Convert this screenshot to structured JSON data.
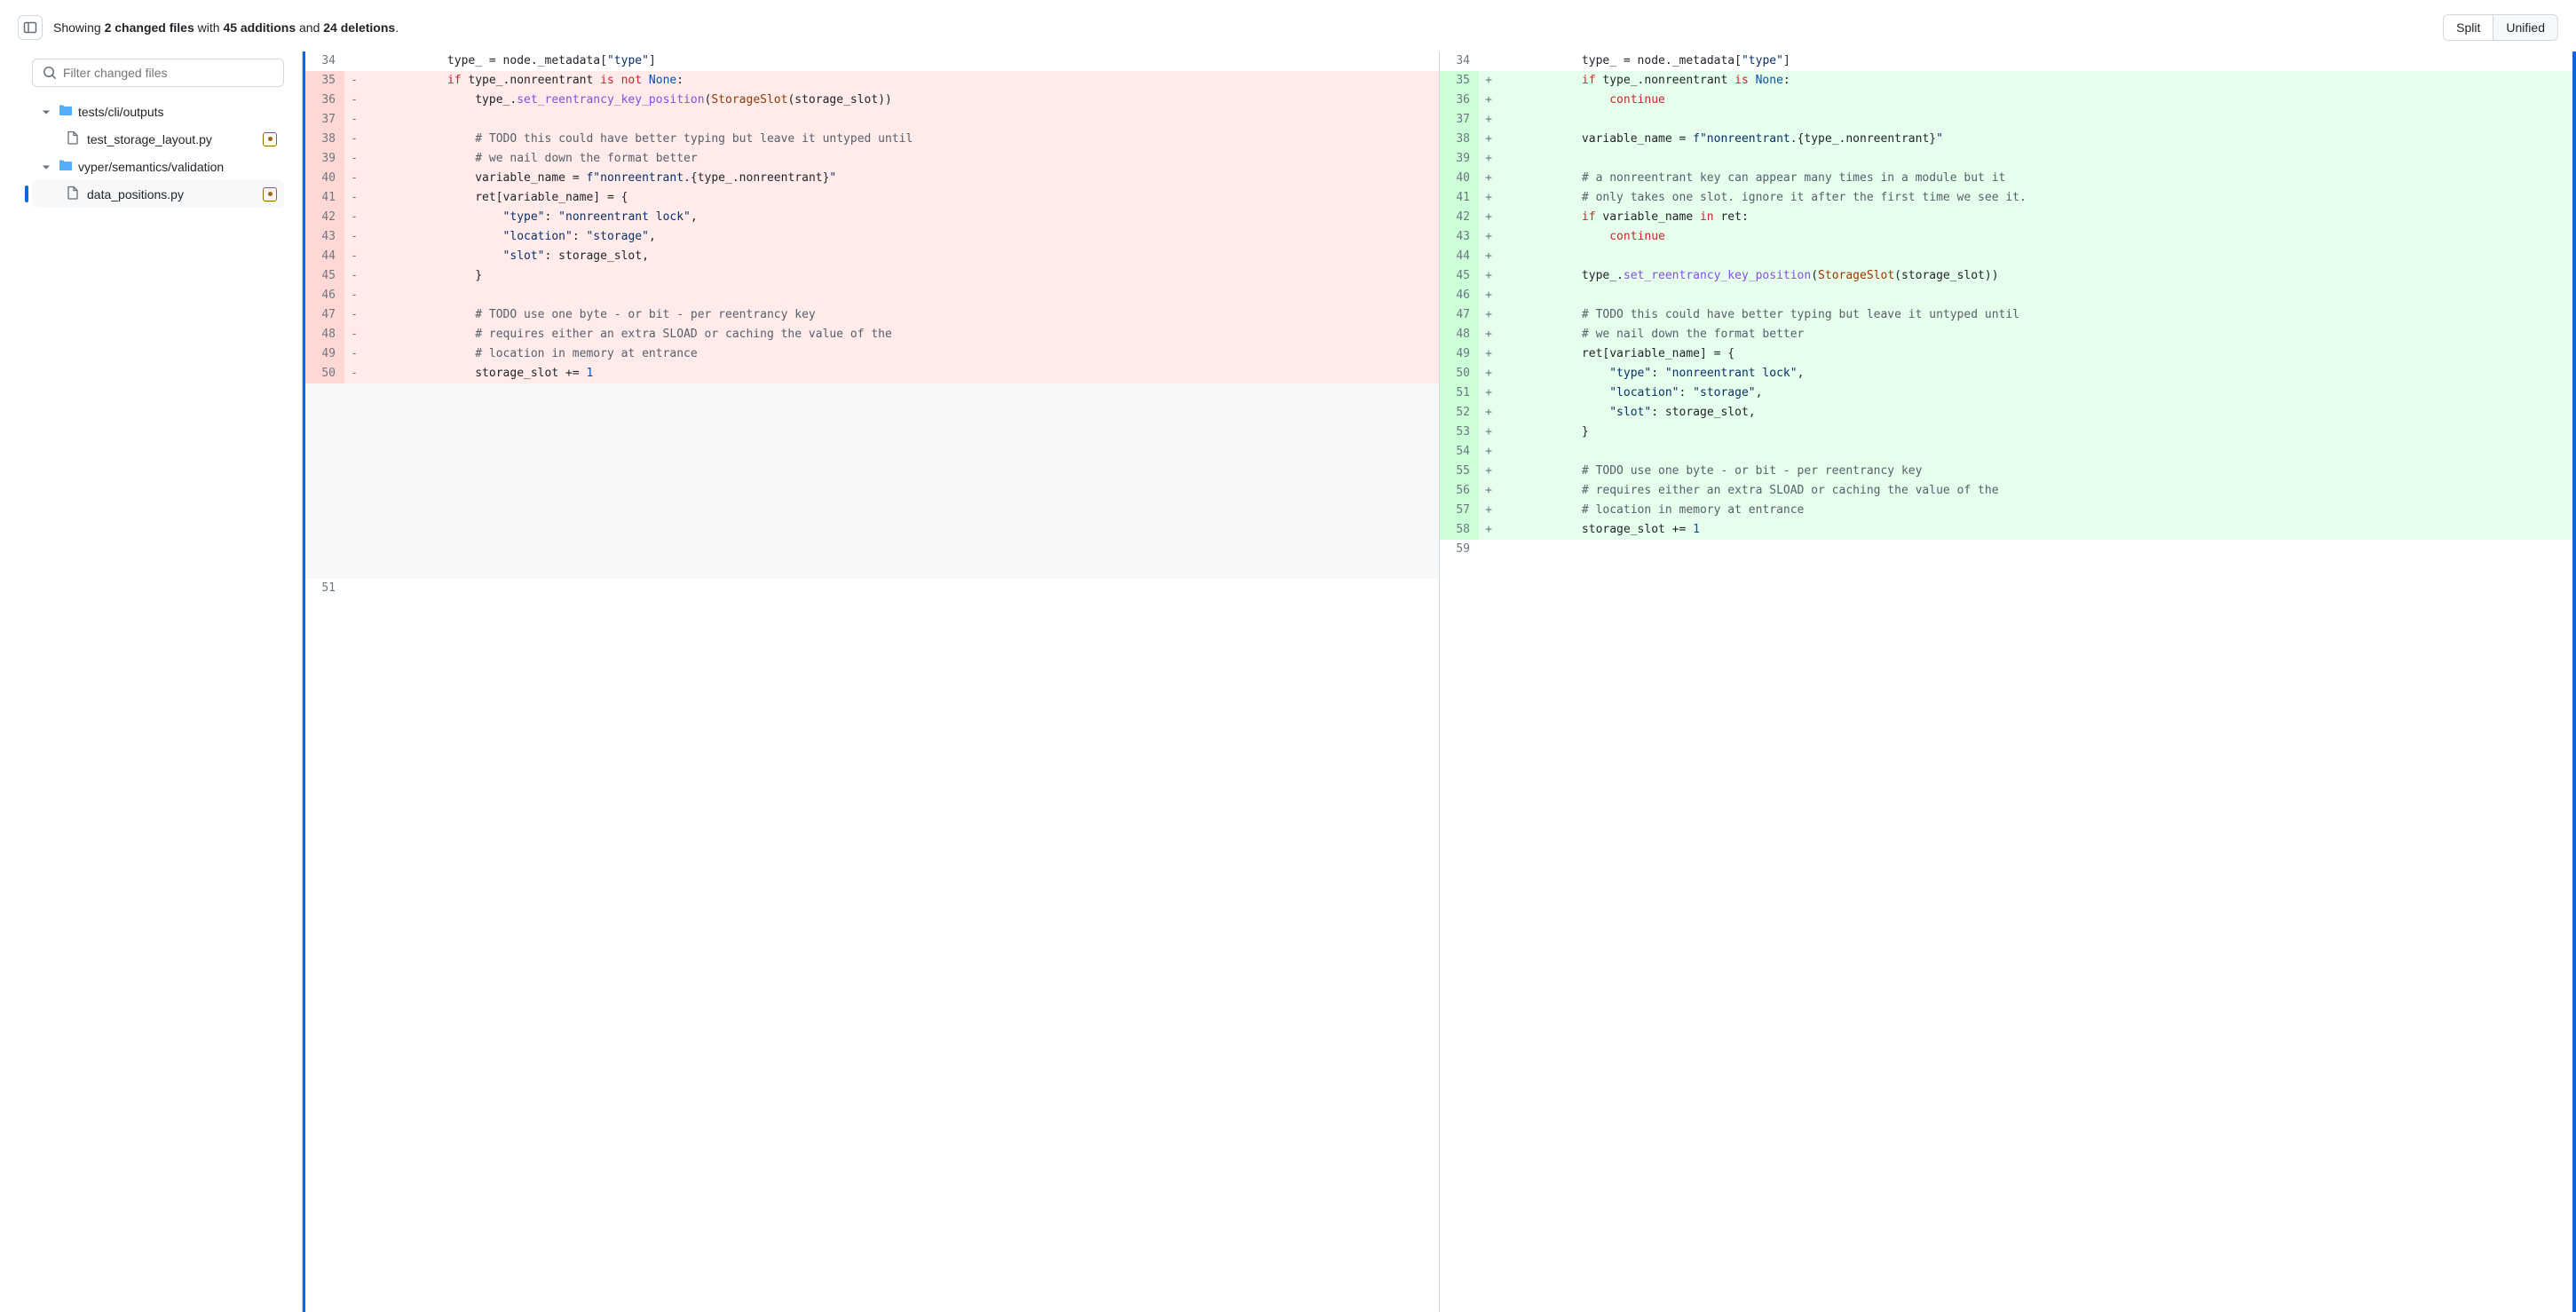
{
  "summary": {
    "prefix": "Showing ",
    "files": "2 changed files",
    "with": " with ",
    "additions": "45 additions",
    "and": " and ",
    "deletions": "24 deletions",
    "period": "."
  },
  "view_toggle": {
    "split": "Split",
    "unified": "Unified"
  },
  "filter": {
    "placeholder": "Filter changed files"
  },
  "tree": {
    "folder1": "tests/cli/outputs",
    "file1": "test_storage_layout.py",
    "folder2": "vyper/semantics/validation",
    "file2": "data_positions.py"
  },
  "diff": {
    "left": [
      {
        "n": "34",
        "t": "ctx",
        "code": [
          [
            "            type_ "
          ],
          [
            "= ",
            ""
          ],
          [
            "node",
            ""
          ],
          [
            ".",
            ""
          ],
          [
            "_metadata",
            ""
          ],
          [
            "[",
            ""
          ],
          [
            "\"type\"",
            "str"
          ],
          [
            "]",
            ""
          ]
        ]
      },
      {
        "n": "35",
        "t": "del",
        "code": [
          [
            "            ",
            ""
          ],
          [
            "if",
            "kw"
          ],
          [
            " type_",
            ""
          ],
          [
            ".",
            ""
          ],
          [
            "nonreentrant ",
            ""
          ],
          [
            "is",
            "kw"
          ],
          [
            " ",
            ""
          ],
          [
            "not",
            "kw"
          ],
          [
            " ",
            ""
          ],
          [
            "None",
            "num"
          ],
          [
            ":",
            ""
          ]
        ]
      },
      {
        "n": "36",
        "t": "del",
        "code": [
          [
            "                type_",
            ""
          ],
          [
            ".",
            ""
          ],
          [
            "set_reentrancy_key_position",
            "fn"
          ],
          [
            "(",
            ""
          ],
          [
            "StorageSlot",
            "cls"
          ],
          [
            "(storage_slot))",
            ""
          ]
        ]
      },
      {
        "n": "37",
        "t": "del",
        "code": [
          [
            "",
            ""
          ]
        ]
      },
      {
        "n": "38",
        "t": "del",
        "code": [
          [
            "                ",
            ""
          ],
          [
            "# TODO this could have better typing but leave it untyped until",
            "cmt"
          ]
        ]
      },
      {
        "n": "39",
        "t": "del",
        "code": [
          [
            "                ",
            ""
          ],
          [
            "# we nail down the format better",
            "cmt"
          ]
        ]
      },
      {
        "n": "40",
        "t": "del",
        "code": [
          [
            "                variable_name ",
            ""
          ],
          [
            "= ",
            ""
          ],
          [
            "f\"nonreentrant.",
            "str"
          ],
          [
            "{",
            ""
          ],
          [
            "type_",
            ""
          ],
          [
            ".",
            ""
          ],
          [
            "nonreentrant",
            ""
          ],
          [
            "}",
            ""
          ],
          [
            "\"",
            "str"
          ]
        ]
      },
      {
        "n": "41",
        "t": "del",
        "code": [
          [
            "                ret[variable_name] ",
            ""
          ],
          [
            "= ",
            ""
          ],
          [
            "{",
            ""
          ]
        ]
      },
      {
        "n": "42",
        "t": "del",
        "code": [
          [
            "                    ",
            ""
          ],
          [
            "\"type\"",
            "str"
          ],
          [
            ": ",
            ""
          ],
          [
            "\"nonreentrant lock\"",
            "str"
          ],
          [
            ",",
            ""
          ]
        ]
      },
      {
        "n": "43",
        "t": "del",
        "code": [
          [
            "                    ",
            ""
          ],
          [
            "\"location\"",
            "str"
          ],
          [
            ": ",
            ""
          ],
          [
            "\"storage\"",
            "str"
          ],
          [
            ",",
            ""
          ]
        ]
      },
      {
        "n": "44",
        "t": "del",
        "code": [
          [
            "                    ",
            ""
          ],
          [
            "\"slot\"",
            "str"
          ],
          [
            ": storage_slot,",
            ""
          ]
        ]
      },
      {
        "n": "45",
        "t": "del",
        "code": [
          [
            "                }",
            ""
          ]
        ]
      },
      {
        "n": "46",
        "t": "del",
        "code": [
          [
            "",
            ""
          ]
        ]
      },
      {
        "n": "47",
        "t": "del",
        "code": [
          [
            "                ",
            ""
          ],
          [
            "# TODO use one byte - or bit - per reentrancy key",
            "cmt"
          ]
        ]
      },
      {
        "n": "48",
        "t": "del",
        "code": [
          [
            "                ",
            ""
          ],
          [
            "# requires either an extra SLOAD or caching the value of the",
            "cmt"
          ]
        ]
      },
      {
        "n": "49",
        "t": "del",
        "code": [
          [
            "                ",
            ""
          ],
          [
            "# location in memory at entrance",
            "cmt"
          ]
        ]
      },
      {
        "n": "50",
        "t": "del",
        "code": [
          [
            "                storage_slot ",
            ""
          ],
          [
            "+= ",
            ""
          ],
          [
            "1",
            "num"
          ]
        ]
      },
      {
        "n": "",
        "t": "empty",
        "code": [
          [
            "",
            ""
          ]
        ]
      },
      {
        "n": "",
        "t": "empty",
        "code": [
          [
            "",
            ""
          ]
        ]
      },
      {
        "n": "",
        "t": "empty",
        "code": [
          [
            "",
            ""
          ]
        ]
      },
      {
        "n": "",
        "t": "empty",
        "code": [
          [
            "",
            ""
          ]
        ]
      },
      {
        "n": "",
        "t": "empty",
        "code": [
          [
            "",
            ""
          ]
        ]
      },
      {
        "n": "",
        "t": "empty",
        "code": [
          [
            "",
            ""
          ]
        ]
      },
      {
        "n": "",
        "t": "empty",
        "code": [
          [
            "",
            ""
          ]
        ]
      },
      {
        "n": "",
        "t": "empty",
        "code": [
          [
            "",
            ""
          ]
        ]
      },
      {
        "n": "",
        "t": "empty",
        "code": [
          [
            "",
            ""
          ]
        ]
      },
      {
        "n": "",
        "t": "empty",
        "code": [
          [
            "",
            ""
          ]
        ]
      },
      {
        "n": "51",
        "t": "ctx",
        "code": [
          [
            "",
            ""
          ]
        ]
      }
    ],
    "right": [
      {
        "n": "34",
        "t": "ctx",
        "code": [
          [
            "            type_ "
          ],
          [
            "= ",
            ""
          ],
          [
            "node",
            ""
          ],
          [
            ".",
            ""
          ],
          [
            "_metadata",
            ""
          ],
          [
            "[",
            ""
          ],
          [
            "\"type\"",
            "str"
          ],
          [
            "]",
            ""
          ]
        ]
      },
      {
        "n": "35",
        "t": "add",
        "code": [
          [
            "            ",
            ""
          ],
          [
            "if",
            "kw"
          ],
          [
            " type_",
            ""
          ],
          [
            ".",
            ""
          ],
          [
            "nonreentrant ",
            ""
          ],
          [
            "is",
            "kw"
          ],
          [
            " ",
            ""
          ],
          [
            "None",
            "num"
          ],
          [
            ":",
            ""
          ]
        ]
      },
      {
        "n": "36",
        "t": "add",
        "code": [
          [
            "                ",
            ""
          ],
          [
            "continue",
            "kw"
          ]
        ]
      },
      {
        "n": "37",
        "t": "add",
        "code": [
          [
            "",
            ""
          ]
        ]
      },
      {
        "n": "38",
        "t": "add",
        "code": [
          [
            "            variable_name ",
            ""
          ],
          [
            "= ",
            ""
          ],
          [
            "f\"nonreentrant.",
            "str"
          ],
          [
            "{",
            ""
          ],
          [
            "type_",
            ""
          ],
          [
            ".",
            ""
          ],
          [
            "nonreentrant",
            ""
          ],
          [
            "}",
            ""
          ],
          [
            "\"",
            "str"
          ]
        ]
      },
      {
        "n": "39",
        "t": "add",
        "code": [
          [
            "",
            ""
          ]
        ]
      },
      {
        "n": "40",
        "t": "add",
        "code": [
          [
            "            ",
            ""
          ],
          [
            "# a nonreentrant key can appear many times in a module but it",
            "cmt"
          ]
        ]
      },
      {
        "n": "41",
        "t": "add",
        "code": [
          [
            "            ",
            ""
          ],
          [
            "# only takes one slot. ignore it after the first time we see it.",
            "cmt"
          ]
        ]
      },
      {
        "n": "42",
        "t": "add",
        "code": [
          [
            "            ",
            ""
          ],
          [
            "if",
            "kw"
          ],
          [
            " variable_name ",
            ""
          ],
          [
            "in",
            "kw"
          ],
          [
            " ret:",
            ""
          ]
        ]
      },
      {
        "n": "43",
        "t": "add",
        "code": [
          [
            "                ",
            ""
          ],
          [
            "continue",
            "kw"
          ]
        ]
      },
      {
        "n": "44",
        "t": "add",
        "code": [
          [
            "",
            ""
          ]
        ]
      },
      {
        "n": "45",
        "t": "add",
        "code": [
          [
            "            type_",
            ""
          ],
          [
            ".",
            ""
          ],
          [
            "set_reentrancy_key_position",
            "fn"
          ],
          [
            "(",
            ""
          ],
          [
            "StorageSlot",
            "cls"
          ],
          [
            "(storage_slot))",
            ""
          ]
        ]
      },
      {
        "n": "46",
        "t": "add",
        "code": [
          [
            "",
            ""
          ]
        ]
      },
      {
        "n": "47",
        "t": "add",
        "code": [
          [
            "            ",
            ""
          ],
          [
            "# TODO this could have better typing but leave it untyped until",
            "cmt"
          ]
        ]
      },
      {
        "n": "48",
        "t": "add",
        "code": [
          [
            "            ",
            ""
          ],
          [
            "# we nail down the format better",
            "cmt"
          ]
        ]
      },
      {
        "n": "49",
        "t": "add",
        "code": [
          [
            "            ret[variable_name] ",
            ""
          ],
          [
            "= ",
            ""
          ],
          [
            "{",
            ""
          ]
        ]
      },
      {
        "n": "50",
        "t": "add",
        "code": [
          [
            "                ",
            ""
          ],
          [
            "\"type\"",
            "str"
          ],
          [
            ": ",
            ""
          ],
          [
            "\"nonreentrant lock\"",
            "str"
          ],
          [
            ",",
            ""
          ]
        ]
      },
      {
        "n": "51",
        "t": "add",
        "code": [
          [
            "                ",
            ""
          ],
          [
            "\"location\"",
            "str"
          ],
          [
            ": ",
            ""
          ],
          [
            "\"storage\"",
            "str"
          ],
          [
            ",",
            ""
          ]
        ]
      },
      {
        "n": "52",
        "t": "add",
        "code": [
          [
            "                ",
            ""
          ],
          [
            "\"slot\"",
            "str"
          ],
          [
            ": storage_slot,",
            ""
          ]
        ]
      },
      {
        "n": "53",
        "t": "add",
        "code": [
          [
            "            }",
            ""
          ]
        ]
      },
      {
        "n": "54",
        "t": "add",
        "code": [
          [
            "",
            ""
          ]
        ]
      },
      {
        "n": "55",
        "t": "add",
        "code": [
          [
            "            ",
            ""
          ],
          [
            "# TODO use one byte - or bit - per reentrancy key",
            "cmt"
          ]
        ]
      },
      {
        "n": "56",
        "t": "add",
        "code": [
          [
            "            ",
            ""
          ],
          [
            "# requires either an extra SLOAD or caching the value of the",
            "cmt"
          ]
        ]
      },
      {
        "n": "57",
        "t": "add",
        "code": [
          [
            "            ",
            ""
          ],
          [
            "# location in memory at entrance",
            "cmt"
          ]
        ]
      },
      {
        "n": "58",
        "t": "add",
        "code": [
          [
            "            storage_slot ",
            ""
          ],
          [
            "+= ",
            ""
          ],
          [
            "1",
            "num"
          ]
        ]
      },
      {
        "n": "59",
        "t": "ctx",
        "code": [
          [
            "",
            ""
          ]
        ]
      }
    ]
  }
}
